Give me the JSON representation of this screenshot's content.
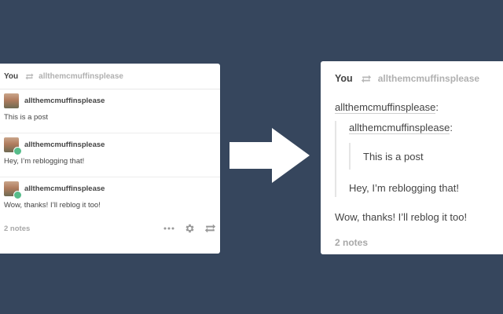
{
  "colors": {
    "background": "#36465d",
    "card": "#ffffff",
    "badge": "#56bc8a",
    "muted": "#a8a8a8"
  },
  "left_post": {
    "header": {
      "user": "You",
      "reblogged_from": "allthemcmuffinsplease",
      "reblog_icon": "reblog-icon"
    },
    "entries": [
      {
        "username": "allthemcmuffinsplease",
        "text": "This is a post"
      },
      {
        "username": "allthemcmuffinsplease",
        "text": "Hey, I’m reblogging that!"
      },
      {
        "username": "allthemcmuffinsplease",
        "text": "Wow, thanks! I’ll reblog it too!"
      }
    ],
    "footer": {
      "notes": "2 notes",
      "icons": [
        "more-icon",
        "gear-icon",
        "reblog-icon"
      ]
    }
  },
  "right_post": {
    "header": {
      "user": "You",
      "reblogged_from": "allthemcmuffinsplease"
    },
    "outer_name": "allthemcmuffinsplease",
    "inner_name": "allthemcmuffinsplease",
    "colon": ":",
    "original_text": "This is a post",
    "reply1": "Hey, I’m reblogging that!",
    "reply2": "Wow, thanks! I’ll reblog it too!",
    "notes": "2 notes"
  }
}
